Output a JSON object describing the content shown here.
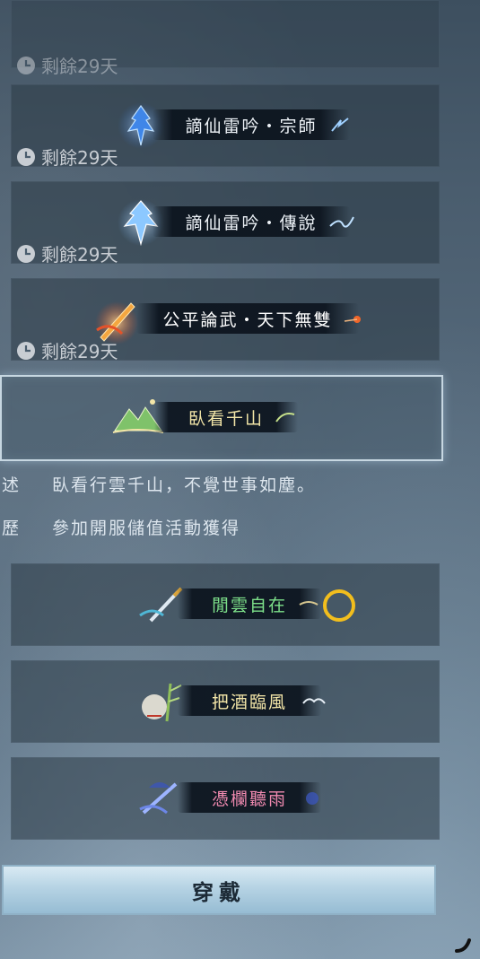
{
  "titles": [
    {
      "id": "partial",
      "name": "",
      "expire": "剩餘29天"
    },
    {
      "id": "zongshi",
      "name": "謫仙雷吟・宗師",
      "expire": "剩餘29天",
      "color": "#eef3f8"
    },
    {
      "id": "chuanshuo",
      "name": "謫仙雷吟・傳說",
      "expire": "剩餘29天",
      "color": "#eef3f8"
    },
    {
      "id": "gongping",
      "name": "公平論武・天下無雙",
      "expire": "剩餘29天",
      "color": "#ffffff"
    },
    {
      "id": "wokan",
      "name": "臥看千山",
      "color": "#f3e6a8"
    },
    {
      "id": "xianyun",
      "name": "閒雲自在",
      "color": "#7de08a"
    },
    {
      "id": "bajiu",
      "name": "把酒臨風",
      "color": "#f3e6a8"
    },
    {
      "id": "pinglan",
      "name": "憑欄聽雨",
      "color": "#f08ab0"
    }
  ],
  "detail": {
    "desc_label": "述",
    "desc_text": "臥看行雲千山，不覺世事如塵。",
    "history_label": "歷",
    "history_text": "參加開服儲值活動獲得"
  },
  "equip_label": "穿戴",
  "icons": [
    "clock-icon",
    "dragon-emblem-icon",
    "sword-emblem-icon",
    "mountain-emblem-icon",
    "blade-emblem-icon",
    "bamboo-emblem-icon",
    "umbrella-emblem-icon",
    "corner-tool-icon"
  ]
}
